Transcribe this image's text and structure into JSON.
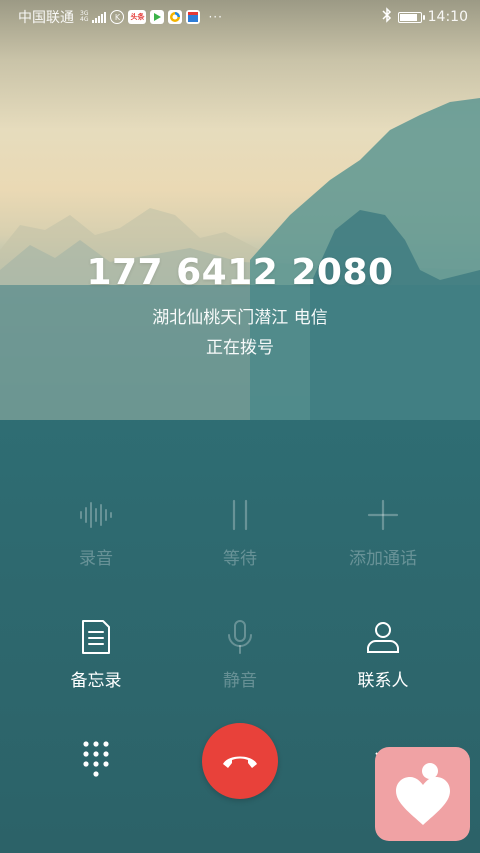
{
  "status_bar": {
    "carrier": "中国联通",
    "network_top": "3G",
    "network_bottom": "4G",
    "app_badge_toutiao": "头条",
    "more_indicator": "···",
    "time": "14:10",
    "battery_level": 0.85,
    "icons": [
      "signal-icon",
      "k-app-icon",
      "toutiao-icon",
      "video-app-icon",
      "browser-app-icon",
      "store-app-icon",
      "bluetooth-icon",
      "battery-icon"
    ]
  },
  "call": {
    "number": "177 6412 2080",
    "location": "湖北仙桃天门潜江 电信",
    "status": "正在拨号"
  },
  "actions": [
    {
      "id": "record",
      "label": "录音",
      "icon": "waveform-icon",
      "enabled": false
    },
    {
      "id": "hold",
      "label": "等待",
      "icon": "pause-icon",
      "enabled": false
    },
    {
      "id": "add_call",
      "label": "添加通话",
      "icon": "plus-icon",
      "enabled": false
    },
    {
      "id": "memo",
      "label": "备忘录",
      "icon": "memo-icon",
      "enabled": true
    },
    {
      "id": "mute",
      "label": "静音",
      "icon": "microphone-icon",
      "enabled": false
    },
    {
      "id": "contacts",
      "label": "联系人",
      "icon": "person-icon",
      "enabled": true
    }
  ],
  "controls": {
    "dialpad_icon": "dialpad-icon",
    "end_call_icon": "hangup-icon",
    "end_call_color": "#e8413a",
    "speaker_icon": "speaker-icon"
  },
  "overlay_app": {
    "icon": "heart-person-icon",
    "color": "#f0a2a4"
  }
}
